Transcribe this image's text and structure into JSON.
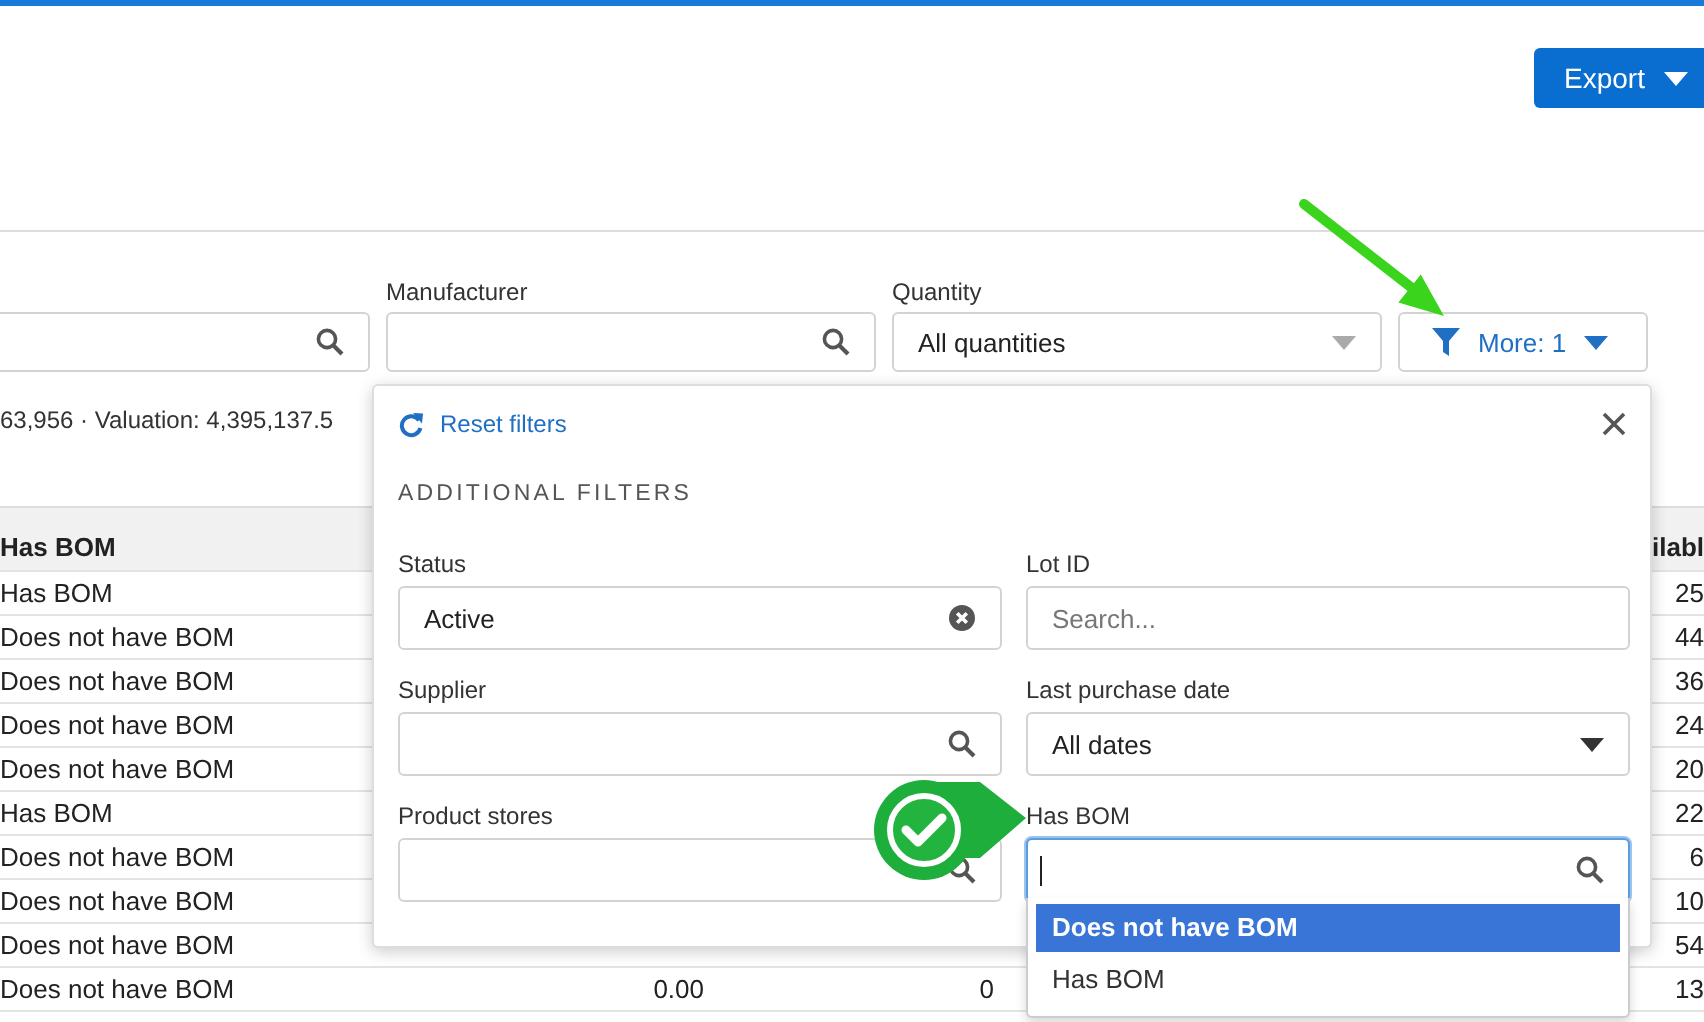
{
  "header": {
    "export_button": "Export"
  },
  "filters": [
    {
      "kind": "search"
    },
    {
      "kind": "search",
      "label": "Manufacturer"
    },
    {
      "kind": "select",
      "label": "Quantity",
      "value": "All quantities"
    }
  ],
  "more_button": {
    "label": "More: 1"
  },
  "summary": "63,956 · Valuation: 4,395,137.5",
  "table": {
    "columns": {
      "has_bom": "Has BOM",
      "column_5": "ilabl"
    },
    "rows": [
      {
        "has_bom": "Has BOM",
        "column_5": "25"
      },
      {
        "has_bom": "Does not have BOM",
        "column_5": "44"
      },
      {
        "has_bom": "Does not have BOM",
        "column_5": "36"
      },
      {
        "has_bom": "Does not have BOM",
        "column_5": "24"
      },
      {
        "has_bom": "Does not have BOM",
        "column_5": "20"
      },
      {
        "has_bom": "Has BOM",
        "column_5": "22"
      },
      {
        "has_bom": "Does not have BOM",
        "column_5": "6"
      },
      {
        "has_bom": "Does not have BOM",
        "column_5": "10"
      },
      {
        "has_bom": "Does not have BOM",
        "column_5": "54"
      },
      {
        "has_bom": "Does not have BOM",
        "column_2": "0.00",
        "column_3": "0",
        "column_5": "13"
      }
    ]
  },
  "filter_panel": {
    "reset_link": "Reset filters",
    "heading": "ADDITIONAL FILTERS",
    "fields": [
      {
        "kind": "clear",
        "label": "Status",
        "value": "Active"
      },
      {
        "kind": "text",
        "label": "Lot ID",
        "placeholder": "Search..."
      },
      {
        "kind": "search",
        "label": "Supplier"
      },
      {
        "kind": "select",
        "label": "Last purchase date",
        "value": "All dates"
      },
      {
        "kind": "search",
        "label": "Product stores"
      },
      {
        "kind": "search",
        "label": "Has BOM",
        "focused": true,
        "options": [
          {
            "label": "Does not have BOM",
            "selected": true
          },
          {
            "label": "Has BOM",
            "selected": false
          }
        ]
      }
    ]
  }
}
